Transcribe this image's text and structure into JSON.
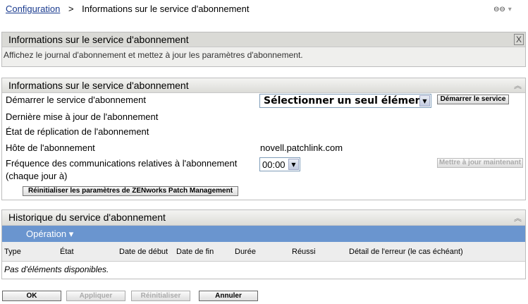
{
  "breadcrumb": {
    "link": "Configuration",
    "separator": ">",
    "current": "Informations sur le service d'abonnement"
  },
  "help_panel": {
    "title": "Informations sur le service d'abonnement",
    "description": "Affichez le journal d'abonnement et mettez à jour les paramètres d'abonnement.",
    "close": "X"
  },
  "info_panel": {
    "title": "Informations sur le service d'abonnement",
    "start_label": "Démarrer le service d'abonnement",
    "start_select": "Sélectionner un seul élément",
    "start_button": "Démarrer le service",
    "last_update_label": "Dernière mise à jour de l'abonnement",
    "replication_label": "État de réplication de l'abonnement",
    "host_label": "Hôte de l'abonnement",
    "host_value": "novell.patchlink.com",
    "frequency_label_1": "Fréquence des communications relatives à l'abonnement",
    "frequency_label_2": "(chaque jour à)",
    "frequency_value": "00:00",
    "update_now_button": "Mettre à jour maintenant",
    "reset_button": "Réinitialiser les paramètres de ZENworks Patch Management"
  },
  "history_panel": {
    "title": "Historique du service d'abonnement",
    "operation_menu": "Opération ▾",
    "columns": [
      "Type",
      "État",
      "Date de début",
      "Date de fin",
      "Durée",
      "Réussi",
      "Détail de l'erreur (le cas échéant)"
    ],
    "empty": "Pas d'éléments disponibles."
  },
  "footer": {
    "ok": "OK",
    "apply": "Appliquer",
    "reset": "Réinitialiser",
    "cancel": "Annuler"
  }
}
